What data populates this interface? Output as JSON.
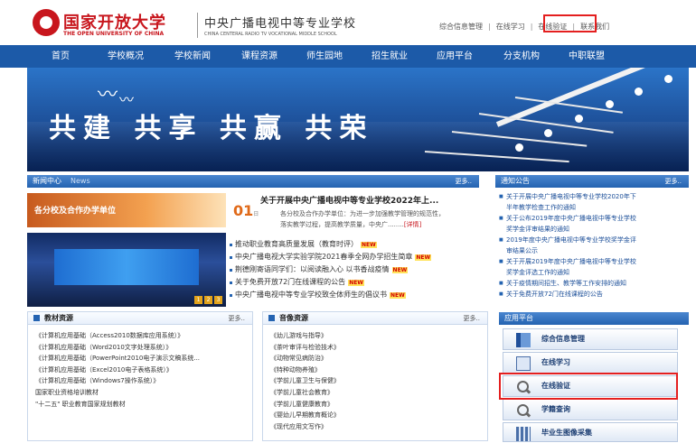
{
  "header": {
    "logo_cn": "国家开放大学",
    "logo_en": "THE OPEN UNIVERSITY OF CHINA",
    "school_cn": "中央广播电视中等专业学校",
    "school_en": "CHINA CENTERAL RADIO TV VOCATIONAL MIDDLE SCHOOL",
    "top_links": [
      "综合信息管理",
      "在线学习",
      "在线验证",
      "联系我们"
    ]
  },
  "nav": [
    "首页",
    "学校概况",
    "学校新闻",
    "课程资源",
    "师生园地",
    "招生就业",
    "应用平台",
    "分支机构",
    "中职联盟"
  ],
  "banner": {
    "slogan": "共建 共享 共赢 共荣"
  },
  "news": {
    "title": "新闻中心",
    "title_en": "News",
    "more": "更多..",
    "image1_label": "各分校及合作办学单位",
    "date_day": "01",
    "date_suffix": "日",
    "feature_title": "关于开展中央广播电视中等专业学校2022年上...",
    "feature_line1": "各分校及合作办学单位：为进一步加强教学管理的规范性，",
    "feature_line2": "落实教学过程，提高教学质量，中央广........",
    "feature_detail": "[详情]",
    "pager": [
      "1",
      "2",
      "3"
    ],
    "items": [
      "推动职业教育高质量发展（教育时评）",
      "中央广播电视大学实验学院2021春季全网办学招生简章",
      "荆德刚寄语同学们：以阅读融入心 以书香战疫情",
      "关于免费开放72门在线课程的公告",
      "中央广播电视中等专业学校致全体师生的倡议书"
    ]
  },
  "notice": {
    "title": "通知公告",
    "more": "更多..",
    "items": [
      [
        "关于开展中央广播电视中等专业学校2020年下",
        "半年教学检查工作的通知"
      ],
      [
        "关于公布2019年度中央广播电视中等专业学校",
        "奖学金评审结果的通知"
      ],
      [
        "2019年度中央广播电视中等专业学校奖学金评",
        "审结果公示"
      ],
      [
        "关于开展2019年度中央广播电视中等专业学校",
        "奖学金评选工作的通知"
      ],
      [
        "关于疫情期间招生、教学等工作安排的通知"
      ],
      [
        "关于免费开放72门在线课程的公告"
      ]
    ]
  },
  "textbook": {
    "title": "教材资源",
    "more": "更多..",
    "items": [
      "《计算机应用基础（Access2010数据库应用系统）》",
      "《计算机应用基础（Word2010文字处理系统）》",
      "《计算机应用基础（PowerPoint2010电子演示文稿系统...",
      "《计算机应用基础（Excel2010电子表格系统）》",
      "《计算机应用基础（Windows7操作系统）》",
      "国家职业资格培训教材",
      "\"十二五\" 职业教育国家规划教材"
    ]
  },
  "video": {
    "title": "音像资源",
    "more": "更多..",
    "items": [
      "《幼儿游戏与指导》",
      "《茶叶审评与检验技术》",
      "《动物常见病防治》",
      "《特种动物养殖》",
      "《学前儿童卫生与保健》",
      "《学前儿童社会教育》",
      "《学前儿童健康教育》",
      "《婴幼儿早期教育概论》",
      "《现代应用文写作》"
    ]
  },
  "app_platform": {
    "title": "应用平台",
    "buttons": [
      "综合信息管理",
      "在线学习",
      "在线验证",
      "学籍查询",
      "毕业生图像采集"
    ]
  },
  "colors": {
    "nav_blue": "#1c5aa8",
    "brand_red": "#c8161d",
    "highlight": "#e41f1f"
  }
}
